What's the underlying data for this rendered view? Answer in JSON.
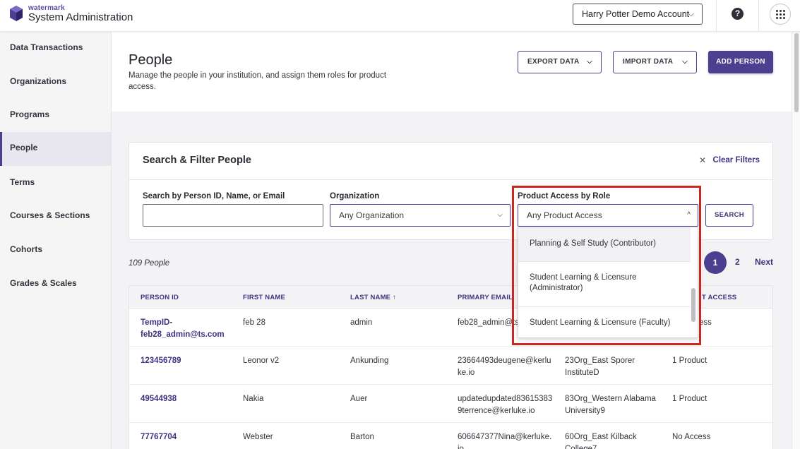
{
  "header": {
    "brand_small": "watermark",
    "brand_title": "System Administration",
    "account": "Harry Potter Demo Account",
    "help_glyph": "?"
  },
  "sidebar": {
    "items": [
      {
        "label": "Data Transactions"
      },
      {
        "label": "Organizations"
      },
      {
        "label": "Programs"
      },
      {
        "label": "People",
        "active": true
      },
      {
        "label": "Terms"
      },
      {
        "label": "Courses & Sections"
      },
      {
        "label": "Cohorts"
      },
      {
        "label": "Grades & Scales"
      }
    ]
  },
  "page": {
    "title": "People",
    "description": "Manage the people in your institution, and assign them roles for product access.",
    "export_label": "EXPORT DATA",
    "import_label": "IMPORT DATA",
    "add_label": "ADD PERSON"
  },
  "filters": {
    "title": "Search & Filter People",
    "clear_label": "Clear Filters",
    "search_label": "Search by Person ID, Name, or Email",
    "search_value": "",
    "org_label": "Organization",
    "org_value": "Any Organization",
    "access_label": "Product Access by Role",
    "access_value": "Any Product Access",
    "search_button": "SEARCH"
  },
  "dropdown": {
    "options": [
      "Planning & Self Study (Contributor)",
      "Student Learning & Licensure (Administrator)",
      "Student Learning & Licensure (Faculty)"
    ]
  },
  "results": {
    "count": "109 People",
    "pages": [
      "1",
      "2"
    ],
    "next_label": "Next"
  },
  "table": {
    "headers": [
      "PERSON ID",
      "FIRST NAME",
      "LAST NAME ↑",
      "PRIMARY EMAIL",
      "PRODUCT ACCESS"
    ],
    "header_access_visible": "T ACCESS",
    "rows": [
      {
        "id": "TempID-feb28_admin@ts.com",
        "first": "feb 28",
        "last": "admin",
        "email": "feb28_admin@ts",
        "org": "",
        "access": "ess"
      },
      {
        "id": "123456789",
        "first": "Leonor v2",
        "last": "Ankunding",
        "email": "23664493deugene@kerluke.io",
        "org": "23Org_East Sporer InstituteD",
        "access": "1 Product"
      },
      {
        "id": "49544938",
        "first": "Nakia",
        "last": "Auer",
        "email": "updatedupdated836153839terrence@kerluke.io",
        "org": "83Org_Western Alabama University9",
        "access": "1 Product"
      },
      {
        "id": "77767704",
        "first": "Webster",
        "last": "Barton",
        "email": "606647377Nina@kerluke.io",
        "org": "60Org_East Kilback College7",
        "access": "No Access"
      }
    ]
  }
}
